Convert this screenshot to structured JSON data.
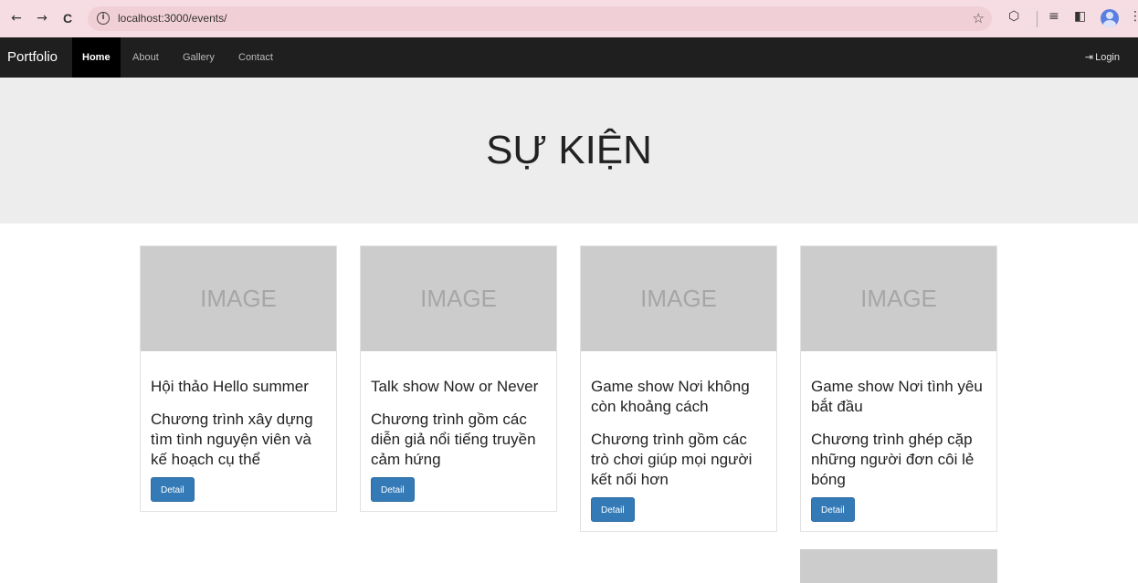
{
  "browser": {
    "url": "localhost:3000/events/",
    "back_icon": "←",
    "forward_icon": "→",
    "reload_icon": "C",
    "info_icon": "i",
    "star_icon": "☆",
    "extension_icon": "⬡",
    "media_icon": "≡",
    "sidepanel_icon": "◧",
    "menu_icon": "⋮"
  },
  "navbar": {
    "brand": "Portfolio",
    "items": [
      {
        "label": "Home",
        "active": true
      },
      {
        "label": "About",
        "active": false
      },
      {
        "label": "Gallery",
        "active": false
      },
      {
        "label": "Contact",
        "active": false
      }
    ],
    "login_icon": "⇥",
    "login_label": "Login"
  },
  "hero": {
    "title": "SỰ KIỆN"
  },
  "events": [
    {
      "image_text": "IMAGE",
      "title": "Hội thảo Hello summer",
      "description": "Chương trình xây dựng tìm tình nguyện viên và kế hoạch cụ thể",
      "button_label": "Detail"
    },
    {
      "image_text": "IMAGE",
      "title": "Talk show Now or Never",
      "description": "Chương trình gồm các diễn giả nổi tiếng truyền cảm hứng",
      "button_label": "Detail"
    },
    {
      "image_text": "IMAGE",
      "title": "Game show Nơi không còn khoảng cách",
      "description": "Chương trình gồm các trò chơi giúp mọi người kết nối hơn",
      "button_label": "Detail"
    },
    {
      "image_text": "IMAGE",
      "title": "Game show Nơi tình yêu bắt đầu",
      "description": "Chương trình ghép cặp những người đơn côi lẻ bóng",
      "button_label": "Detail"
    }
  ]
}
